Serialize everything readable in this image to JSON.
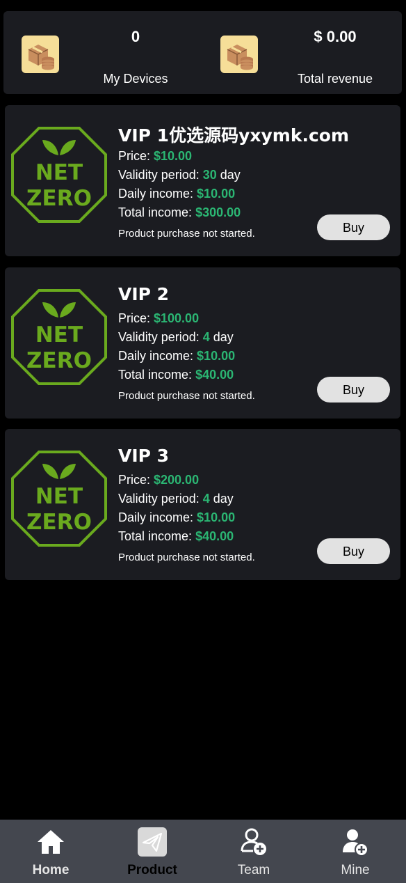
{
  "summary": {
    "devices_value": "0",
    "devices_label": "My Devices",
    "revenue_value": "$ 0.00",
    "revenue_label": "Total revenue",
    "icon": "package-coins-icon"
  },
  "labels": {
    "price": "Price: ",
    "validity": "Validity period: ",
    "day_unit": " day",
    "daily_income": "Daily income: ",
    "total_income": "Total income: ",
    "buy": "Buy"
  },
  "products": [
    {
      "title": "VIP 1优选源码yxymk.com",
      "price": "$10.00",
      "validity": "30",
      "daily_income": "$10.00",
      "total_income": "$300.00",
      "status": "Product purchase not started.",
      "logo_text_1": "NET",
      "logo_text_2": "ZERO"
    },
    {
      "title": "VIP 2",
      "price": "$100.00",
      "validity": "4",
      "daily_income": "$10.00",
      "total_income": "$40.00",
      "status": "Product purchase not started.",
      "logo_text_1": "NET",
      "logo_text_2": "ZERO"
    },
    {
      "title": "VIP 3",
      "price": "$200.00",
      "validity": "4",
      "daily_income": "$10.00",
      "total_income": "$40.00",
      "status": "Product purchase not started.",
      "logo_text_1": "NET",
      "logo_text_2": "ZERO"
    }
  ],
  "tabs": [
    {
      "label": "Home",
      "icon": "home-icon",
      "active": true
    },
    {
      "label": "Product",
      "icon": "paper-plane-icon",
      "active": true
    },
    {
      "label": "Team",
      "icon": "user-add-icon",
      "active": false
    },
    {
      "label": "Mine",
      "icon": "user-plus-icon",
      "active": false
    }
  ],
  "colors": {
    "accent_green": "#2bb673",
    "logo_green": "#6aaa1e",
    "card_bg": "#1b1c21",
    "tabbar_bg": "#44474f",
    "icon_bg": "#f6de98"
  }
}
